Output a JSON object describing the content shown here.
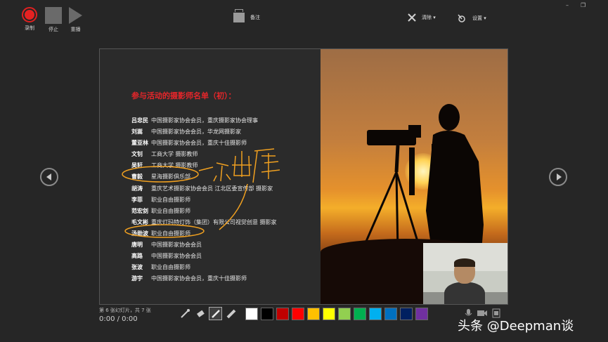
{
  "toolbar": {
    "record_label": "录制",
    "stop_label": "停止",
    "replay_label": "重播",
    "notes_label": "备注",
    "clear_label": "清除 ▾",
    "settings_label": "设置 ▾"
  },
  "window_controls": {
    "minimize": "–",
    "restore": "❐"
  },
  "slide": {
    "title": "参与活动的摄影师名单（初）：",
    "people": [
      {
        "name": "吕忠民",
        "desc": "中国摄影家协会会员，重庆摄影家协会理事"
      },
      {
        "name": "刘嵩",
        "desc": "中国摄影家协会会员，华龙网摄影家"
      },
      {
        "name": "董亚林",
        "desc": "中国摄影家协会会员，重庆十佳摄影师"
      },
      {
        "name": "文钊",
        "desc": "工商大学 摄影教师"
      },
      {
        "name": "吴轩",
        "desc": "工商大学 摄影教师"
      },
      {
        "name": "曹毅",
        "desc": "星海摄影俱乐部"
      },
      {
        "name": "胡涛",
        "desc": "重庆艺术摄影家协会会员 江北区委宣传部 摄影家"
      },
      {
        "name": "李菲",
        "desc": "职业自由摄影师"
      },
      {
        "name": "范宏剑",
        "desc": "职业自由摄影师"
      },
      {
        "name": "毛文彬",
        "desc": "重庆灯玛特灯饰（集团）有限公司视觉创意 摄影家"
      },
      {
        "name": "汤勋波",
        "desc": "职业自由摄影师"
      },
      {
        "name": "唐明",
        "desc": "中国摄影家协会会员"
      },
      {
        "name": "高路",
        "desc": "中国摄影家协会会员"
      },
      {
        "name": "张波",
        "desc": "职业自由摄影师"
      },
      {
        "name": "游宇",
        "desc": "中国摄影家协会会员，重庆十佳摄影师"
      }
    ],
    "annotation": "不出席"
  },
  "status": {
    "slide_count": "第 6 张幻灯片，共 7 张",
    "time": "0:00 / 0:00"
  },
  "ink": {
    "pen_color": "#f0a020",
    "colors": [
      "#ffffff",
      "#000000",
      "#c00000",
      "#ff0000",
      "#ffc000",
      "#ffff00",
      "#92d050",
      "#00b050",
      "#00b0f0",
      "#0070c0",
      "#002060",
      "#7030a0"
    ]
  },
  "watermark": "头条 @Deepman谈"
}
